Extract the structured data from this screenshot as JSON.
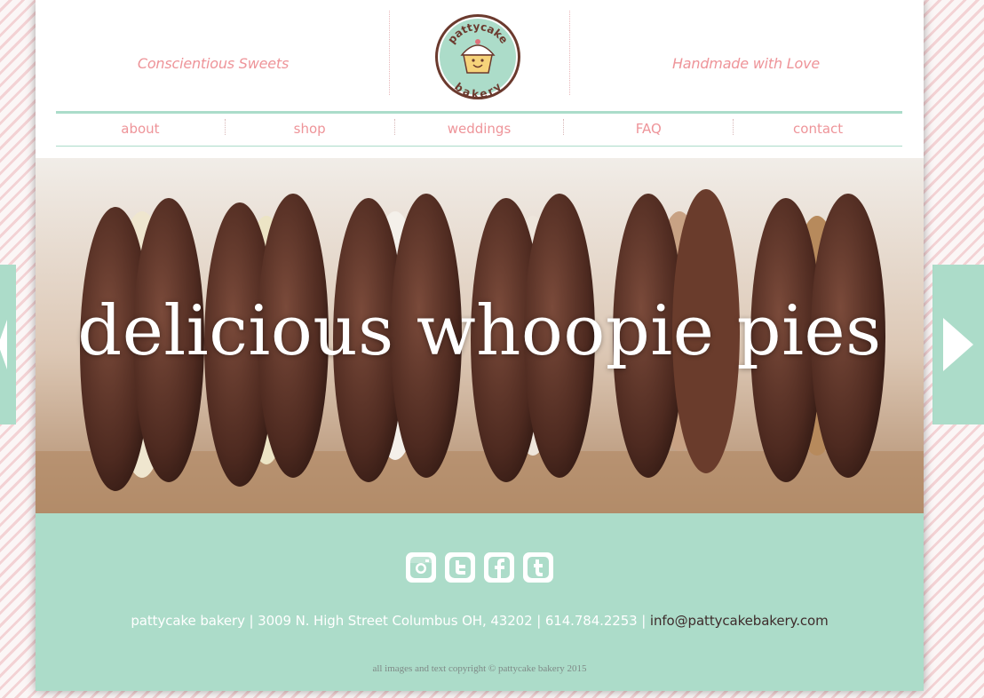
{
  "header": {
    "tagline_left": "Conscientious Sweets",
    "tagline_right": "Handmade with Love",
    "logo_text_top": "pattycake",
    "logo_text_bottom": "bakery"
  },
  "nav": {
    "items": [
      {
        "label": "about"
      },
      {
        "label": "shop"
      },
      {
        "label": "weddings"
      },
      {
        "label": "FAQ"
      },
      {
        "label": "contact"
      }
    ]
  },
  "hero": {
    "caption": "delicious whoopie pies"
  },
  "footer": {
    "social_icons": [
      "instagram-icon",
      "twitter-icon",
      "facebook-icon",
      "tumblr-icon"
    ],
    "address": "pattycake bakery | 3009 N. High Street Columbus OH, 43202 | 614.784.2253 | ",
    "email": "info@pattycakebakery.com",
    "copyright": "all images and text copyright © pattycake bakery 2015"
  },
  "colors": {
    "mint": "#acdcc9",
    "pink": "#ee9499",
    "dark_brown": "#3e2c2c"
  }
}
